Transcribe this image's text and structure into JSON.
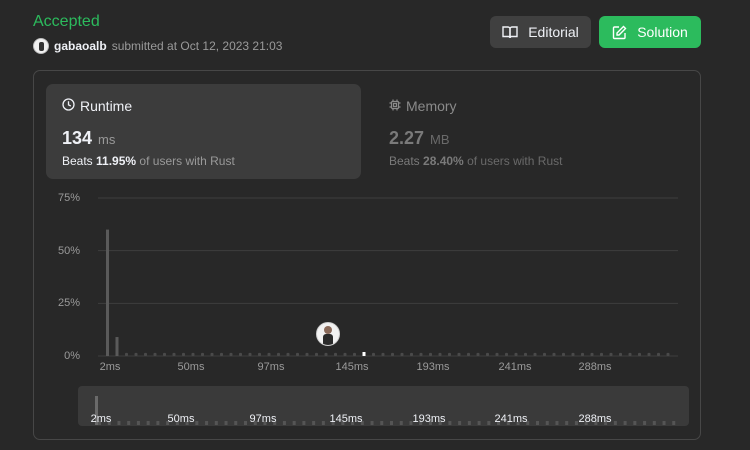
{
  "status": "Accepted",
  "submission": {
    "user": "gabaoalb",
    "text": "submitted at Oct 12, 2023 21:03"
  },
  "buttons": {
    "editorial": "Editorial",
    "solution": "Solution"
  },
  "runtime": {
    "label": "Runtime",
    "value": "134",
    "unit": "ms",
    "beats_prefix": "Beats",
    "beats_pct": "11.95%",
    "beats_suffix": "of users with Rust"
  },
  "memory": {
    "label": "Memory",
    "value": "2.27",
    "unit": "MB",
    "beats_prefix": "Beats",
    "beats_pct": "28.40%",
    "beats_suffix": "of users with Rust"
  },
  "colors": {
    "accent": "#2cbb5d",
    "bar": "#5a5a5a",
    "bar_small": "#4a4a4a"
  },
  "chart_data": {
    "type": "bar",
    "yticks": [
      "75%",
      "50%",
      "25%",
      "0%"
    ],
    "ylim": [
      0,
      75
    ],
    "xticks": [
      "2ms",
      "50ms",
      "97ms",
      "145ms",
      "193ms",
      "241ms",
      "288ms"
    ],
    "xlim": [
      0,
      300
    ],
    "user_runtime_ms": 134,
    "bars": [
      {
        "x": 2,
        "y": 60
      },
      {
        "x": 6,
        "y": 9
      }
    ],
    "baseline_bar_count": 60,
    "baseline_value": 1.5
  },
  "minimap": {
    "xticks": [
      "2ms",
      "50ms",
      "97ms",
      "145ms",
      "193ms",
      "241ms",
      "288ms"
    ]
  }
}
